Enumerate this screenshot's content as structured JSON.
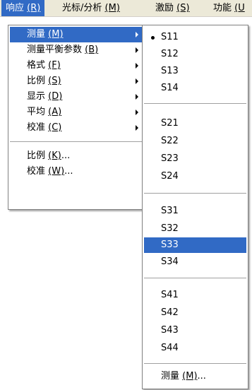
{
  "menubar": {
    "items": [
      {
        "label": "响应",
        "accel": "(R)"
      },
      {
        "label": "光标/分析",
        "accel": "(M)"
      },
      {
        "label": "激励",
        "accel": "(S)"
      },
      {
        "label": "功能",
        "accel": "(U"
      }
    ]
  },
  "response_menu": {
    "items": [
      {
        "label": "测量",
        "accel": "(M)"
      },
      {
        "label": "测量平衡参数",
        "accel": "(B)"
      },
      {
        "label": "格式",
        "accel": "(F)"
      },
      {
        "label": "比例",
        "accel": "(S)"
      },
      {
        "label": "显示",
        "accel": "(D)"
      },
      {
        "label": "平均",
        "accel": "(A)"
      },
      {
        "label": "校准",
        "accel": "(C)"
      },
      {
        "label": "比例",
        "accel": "(K)",
        "suffix": "..."
      },
      {
        "label": "校准",
        "accel": "(W)",
        "suffix": "..."
      }
    ]
  },
  "measure_submenu": {
    "items": [
      "S11",
      "S12",
      "S13",
      "S14",
      "S21",
      "S22",
      "S23",
      "S24",
      "S31",
      "S32",
      "S33",
      "S34",
      "S41",
      "S42",
      "S43",
      "S44"
    ],
    "more": {
      "label": "测量",
      "accel": "(M)",
      "suffix": "..."
    }
  },
  "colors": {
    "highlight": "#316ac5",
    "menubar": "#ece9d8"
  }
}
